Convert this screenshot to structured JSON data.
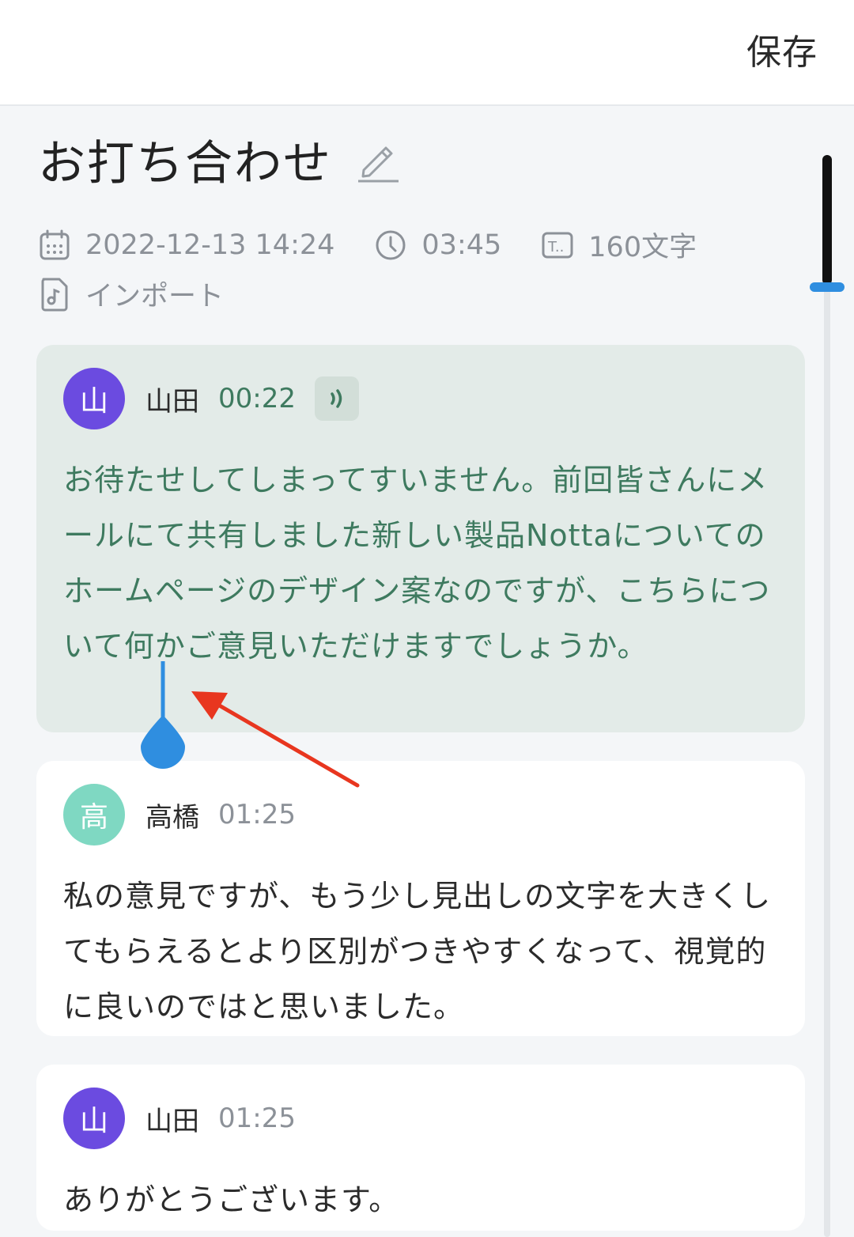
{
  "header": {
    "save_label": "保存"
  },
  "note": {
    "title": "お打ち合わせ",
    "meta": {
      "datetime": "2022-12-13 14:24",
      "duration": "03:45",
      "char_count": "160文字",
      "source": "インポート"
    }
  },
  "colors": {
    "active_text": "#3e7a5f",
    "active_card_bg": "#e3ebe8",
    "avatar_purple": "#6b4be0",
    "avatar_teal": "#7fd8c2",
    "caret_blue": "#2f8ee0",
    "annotation_arrow": "#e8361f"
  },
  "transcript": [
    {
      "avatar": "山",
      "speaker": "山田",
      "time": "00:22",
      "text": "お待たせしてしまってすいません。前回皆さんにメールにて共有しました新しい製品Nottaについてのホームページのデザイン案なのですが、こちらについて何かご意見いただけますでしょうか。",
      "active": true
    },
    {
      "avatar": "高",
      "speaker": "高橋",
      "time": "01:25",
      "text": "私の意見ですが、もう少し見出しの文字を大きくしてもらえるとより区別がつきやすくなって、視覚的に良いのではと思いました。"
    },
    {
      "avatar": "山",
      "speaker": "山田",
      "time": "01:25",
      "text": "ありがとうございます。"
    }
  ]
}
